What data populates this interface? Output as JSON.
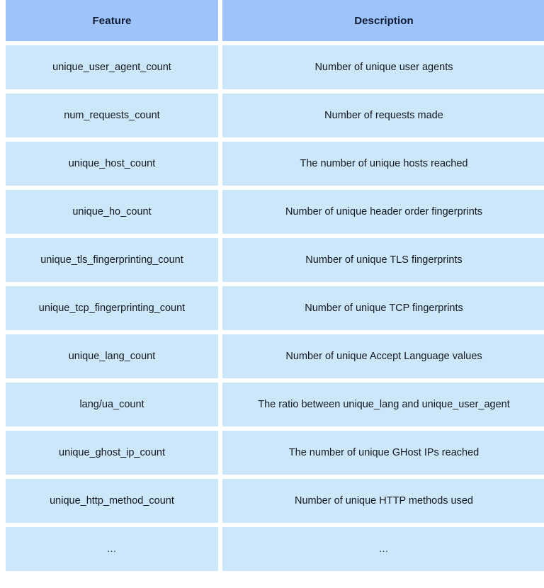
{
  "table": {
    "columns": [
      {
        "key": "feature",
        "label": "Feature"
      },
      {
        "key": "description",
        "label": "Description"
      }
    ],
    "rows": [
      {
        "feature": "unique_user_agent_count",
        "description": "Number of unique user agents"
      },
      {
        "feature": "num_requests_count",
        "description": "Number of requests made"
      },
      {
        "feature": "unique_host_count",
        "description": "The number of unique hosts reached"
      },
      {
        "feature": "unique_ho_count",
        "description": "Number of unique header order fingerprints"
      },
      {
        "feature": "unique_tls_fingerprinting_count",
        "description": "Number of unique TLS fingerprints"
      },
      {
        "feature": "unique_tcp_fingerprinting_count",
        "description": "Number of unique TCP fingerprints"
      },
      {
        "feature": "unique_lang_count",
        "description": "Number of unique Accept Language values"
      },
      {
        "feature": "lang/ua_count",
        "description": "The ratio between unique_lang and unique_user_agent"
      },
      {
        "feature": "unique_ghost_ip_count",
        "description": "The number of unique GHost IPs reached"
      },
      {
        "feature": "unique_http_method_count",
        "description": "Number of unique HTTP methods used"
      },
      {
        "feature": "…",
        "description": "…"
      }
    ]
  },
  "colors": {
    "header_background": "#9ec3fa",
    "row_background": "#cce7fa",
    "page_background": "#ffffff",
    "header_text": "#0d1b33",
    "body_text": "#14181f"
  }
}
